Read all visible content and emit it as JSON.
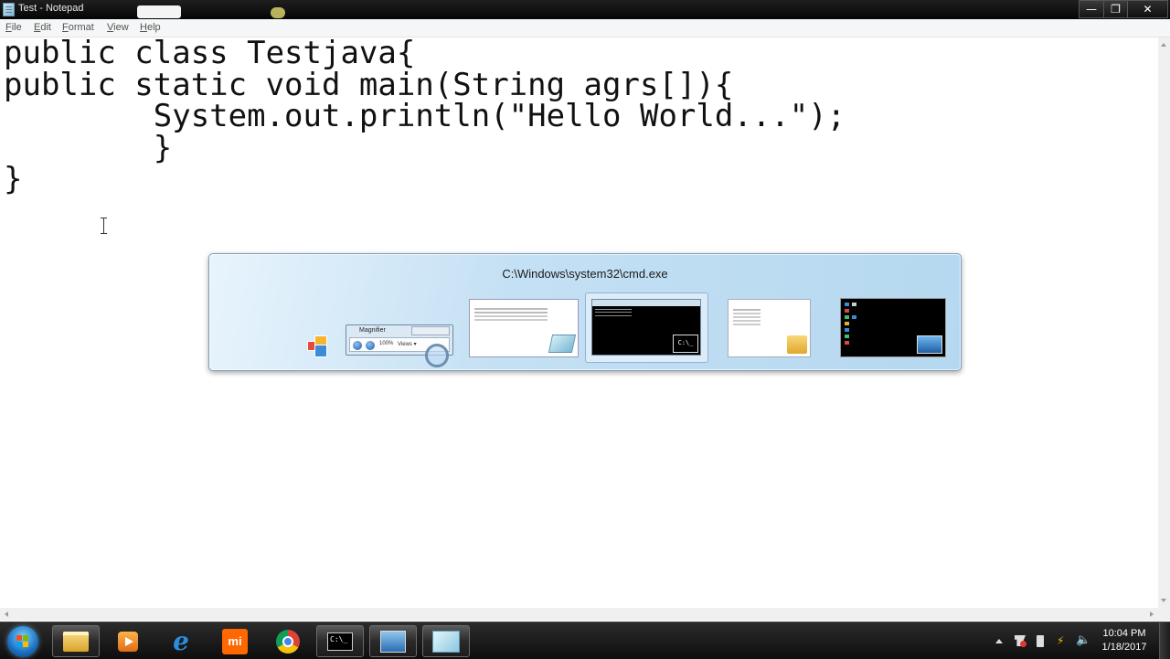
{
  "window": {
    "title": "Test - Notepad",
    "buttons": {
      "minimize": "—",
      "maximize": "❐",
      "close": "✕"
    }
  },
  "menu": {
    "items": [
      {
        "label": "File"
      },
      {
        "label": "Edit"
      },
      {
        "label": "Format"
      },
      {
        "label": "View"
      },
      {
        "label": "Help"
      }
    ]
  },
  "editor": {
    "content": "public class Testjava{\npublic static void main(String agrs[]){\n        System.out.println(\"Hello World...\");\n        }\n}"
  },
  "switcher": {
    "selected_title": "C:\\Windows\\system32\\cmd.exe",
    "magnifier_title": "Magnifier",
    "magnifier_zoom": "100%",
    "magnifier_views": "Views ▾",
    "cmd_icon_text": "C:\\_",
    "items": [
      {
        "icon": "desktop-switcher-icon"
      },
      {
        "icon": "magnifier-window-thumbnail"
      },
      {
        "icon": "notepad-window-thumbnail"
      },
      {
        "icon": "cmd-window-thumbnail",
        "selected": true
      },
      {
        "icon": "explorer-window-thumbnail"
      },
      {
        "icon": "desktop-thumbnail"
      }
    ]
  },
  "taskbar": {
    "pinned": [
      {
        "icon": "explorer-icon"
      },
      {
        "icon": "media-player-icon"
      },
      {
        "icon": "internet-explorer-icon",
        "glyph": "e"
      },
      {
        "icon": "mi-icon",
        "glyph": "mi"
      },
      {
        "icon": "chrome-icon"
      },
      {
        "icon": "cmd-icon",
        "glyph": "C:\\_",
        "active": true
      },
      {
        "icon": "magnifier-icon",
        "active": true
      },
      {
        "icon": "notepad-icon",
        "active": true
      }
    ],
    "tray": {
      "network_glyph": "⚡",
      "volume_glyph": "🔈"
    },
    "clock": {
      "time": "10:04 PM",
      "date": "1/18/2017"
    }
  }
}
